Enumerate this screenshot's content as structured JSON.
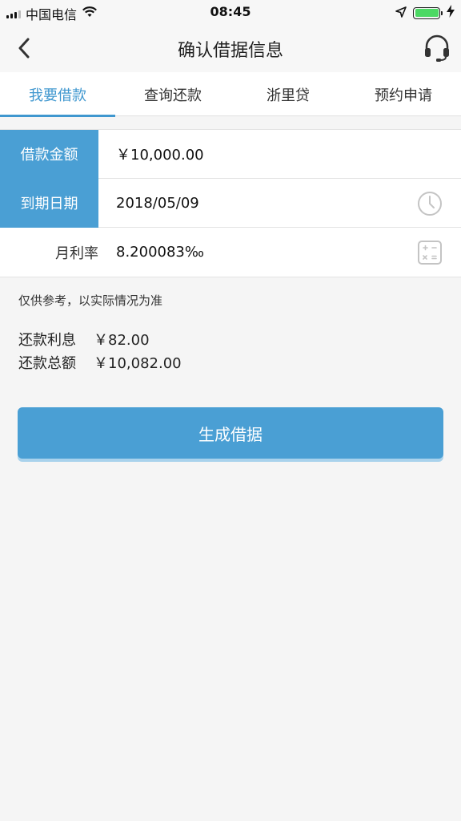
{
  "status_bar": {
    "carrier": "中国电信",
    "time": "08:45"
  },
  "nav": {
    "title": "确认借据信息",
    "back_icon": "chevron-left-icon",
    "support_icon": "headset-icon"
  },
  "tabs": [
    {
      "label": "我要借款",
      "active": true
    },
    {
      "label": "查询还款",
      "active": false
    },
    {
      "label": "浙里贷",
      "active": false
    },
    {
      "label": "预约申请",
      "active": false
    }
  ],
  "form": {
    "amount": {
      "label": "借款金额",
      "value": "￥10,000.00"
    },
    "due_date": {
      "label": "到期日期",
      "value": "2018/05/09",
      "icon": "clock-icon"
    },
    "rate": {
      "label": "月利率",
      "value": "8.200083‰",
      "icon": "calculator-icon"
    }
  },
  "note": "仅供参考，以实际情况为准",
  "summary": {
    "interest": {
      "label": "还款利息",
      "value": "￥82.00"
    },
    "total": {
      "label": "还款总额",
      "value": "￥10,082.00"
    }
  },
  "primary_button": {
    "label": "生成借据"
  },
  "colors": {
    "accent": "#4a9fd4",
    "battery": "#4cd964"
  }
}
